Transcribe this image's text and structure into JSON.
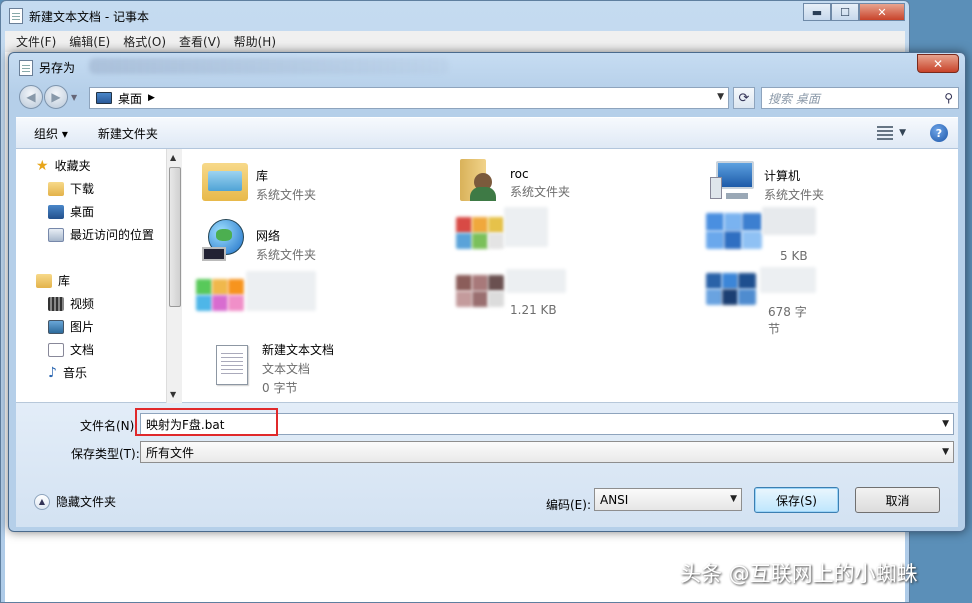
{
  "notepad": {
    "title": "新建文本文档 - 记事本",
    "menu": [
      "文件(F)",
      "编辑(E)",
      "格式(O)",
      "查看(V)",
      "帮助(H)"
    ],
    "controls": {
      "minimize": "▬",
      "maximize": "☐",
      "close": "✕"
    }
  },
  "dialog": {
    "title": "另存为",
    "address": {
      "location": "桌面",
      "separator": "▶"
    },
    "search_placeholder": "搜索 桌面",
    "toolbar": {
      "organize": "组织 ▾",
      "new_folder": "新建文件夹"
    },
    "nav": {
      "favorites": "收藏夹",
      "downloads": "下载",
      "desktop": "桌面",
      "recent": "最近访问的位置",
      "libraries": "库",
      "videos": "视频",
      "pictures": "图片",
      "documents": "文档",
      "music": "音乐"
    },
    "files": [
      {
        "name": "库",
        "desc": "系统文件夹"
      },
      {
        "name": "roc",
        "desc": "系统文件夹"
      },
      {
        "name": "计算机",
        "desc": "系统文件夹"
      },
      {
        "name": "网络",
        "desc": "系统文件夹"
      },
      {
        "name": "",
        "desc": ""
      },
      {
        "name": "",
        "desc": "",
        "extra": "5 KB"
      },
      {
        "name": "",
        "desc": ""
      },
      {
        "name": "",
        "desc": "1.21 KB"
      },
      {
        "name": "",
        "desc": "678 字节"
      },
      {
        "name": "新建文本文档",
        "desc": "文本文档",
        "size": "0 字节"
      }
    ],
    "filename_label": "文件名(N):",
    "filename_value": "映射为F盘.bat",
    "filetype_label": "保存类型(T):",
    "filetype_value": "所有文件",
    "hide_folders": "隐藏文件夹",
    "encoding_label": "编码(E):",
    "encoding_value": "ANSI",
    "save": "保存(S)",
    "cancel": "取消"
  },
  "watermark": "头条 @互联网上的小蜘蛛"
}
